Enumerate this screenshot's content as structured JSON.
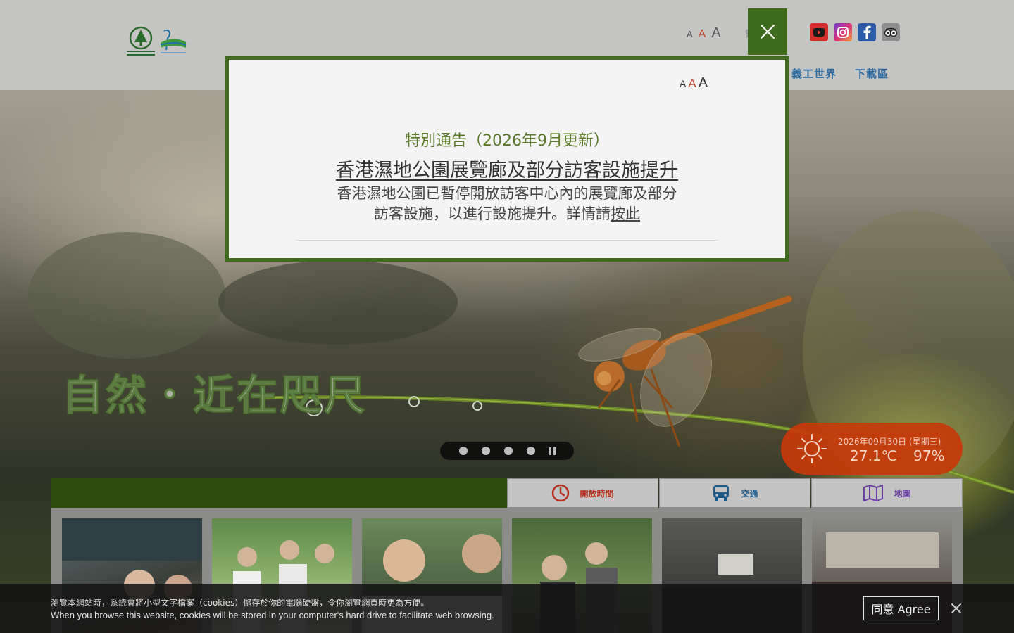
{
  "header": {
    "logo_label": "Agriculture, Fisheries and Conservation Department",
    "font_size_options": [
      "A",
      "A",
      "A"
    ],
    "lang_label": "繁",
    "social": [
      "youtube-icon",
      "instagram-icon",
      "facebook-icon",
      "tripadvisor-icon"
    ],
    "nav": [
      "義工世界",
      "下載區"
    ]
  },
  "hero": {
    "headline": "自然・近在咫尺"
  },
  "carousel": {
    "slides": 4,
    "pause_label": "pause"
  },
  "weather": {
    "date": "2026年09月30日 (星期三)",
    "temperature": "27.1℃",
    "humidity": "97%"
  },
  "quick_links": [
    {
      "label": "開放時間",
      "icon": "clock-icon",
      "color": "#b5301e"
    },
    {
      "label": "交通",
      "icon": "bus-icon",
      "color": "#1d5a8c"
    },
    {
      "label": "地圖",
      "icon": "map-icon",
      "color": "#6a3fa0"
    }
  ],
  "notice": {
    "font_size_options": [
      "A",
      "A",
      "A"
    ],
    "title": "特別通告（2026年9月更新）",
    "heading": "香港濕地公園展覽廊及部分訪客設施提升",
    "body_line1": "香港濕地公園已暫停開放訪客中心內的展覽廊及部分",
    "body_line2_prefix": "訪客設施，以進行設施提升。詳情請",
    "link_text": "按此"
  },
  "cookie": {
    "text_zh": "瀏覽本網站時，系統會將小型文字檔案（cookies）儲存於你的電腦硬盤，令你瀏覽網頁時更為方便。",
    "text_en": "When you browse this website, cookies will be stored in your computer's hard drive to facilitate web browsing.",
    "agree_label": "同意 Agree"
  },
  "colors": {
    "brand_green": "#3f6b1e",
    "weather_orange": "#c8370a",
    "nav_blue": "#2c6aa0"
  }
}
